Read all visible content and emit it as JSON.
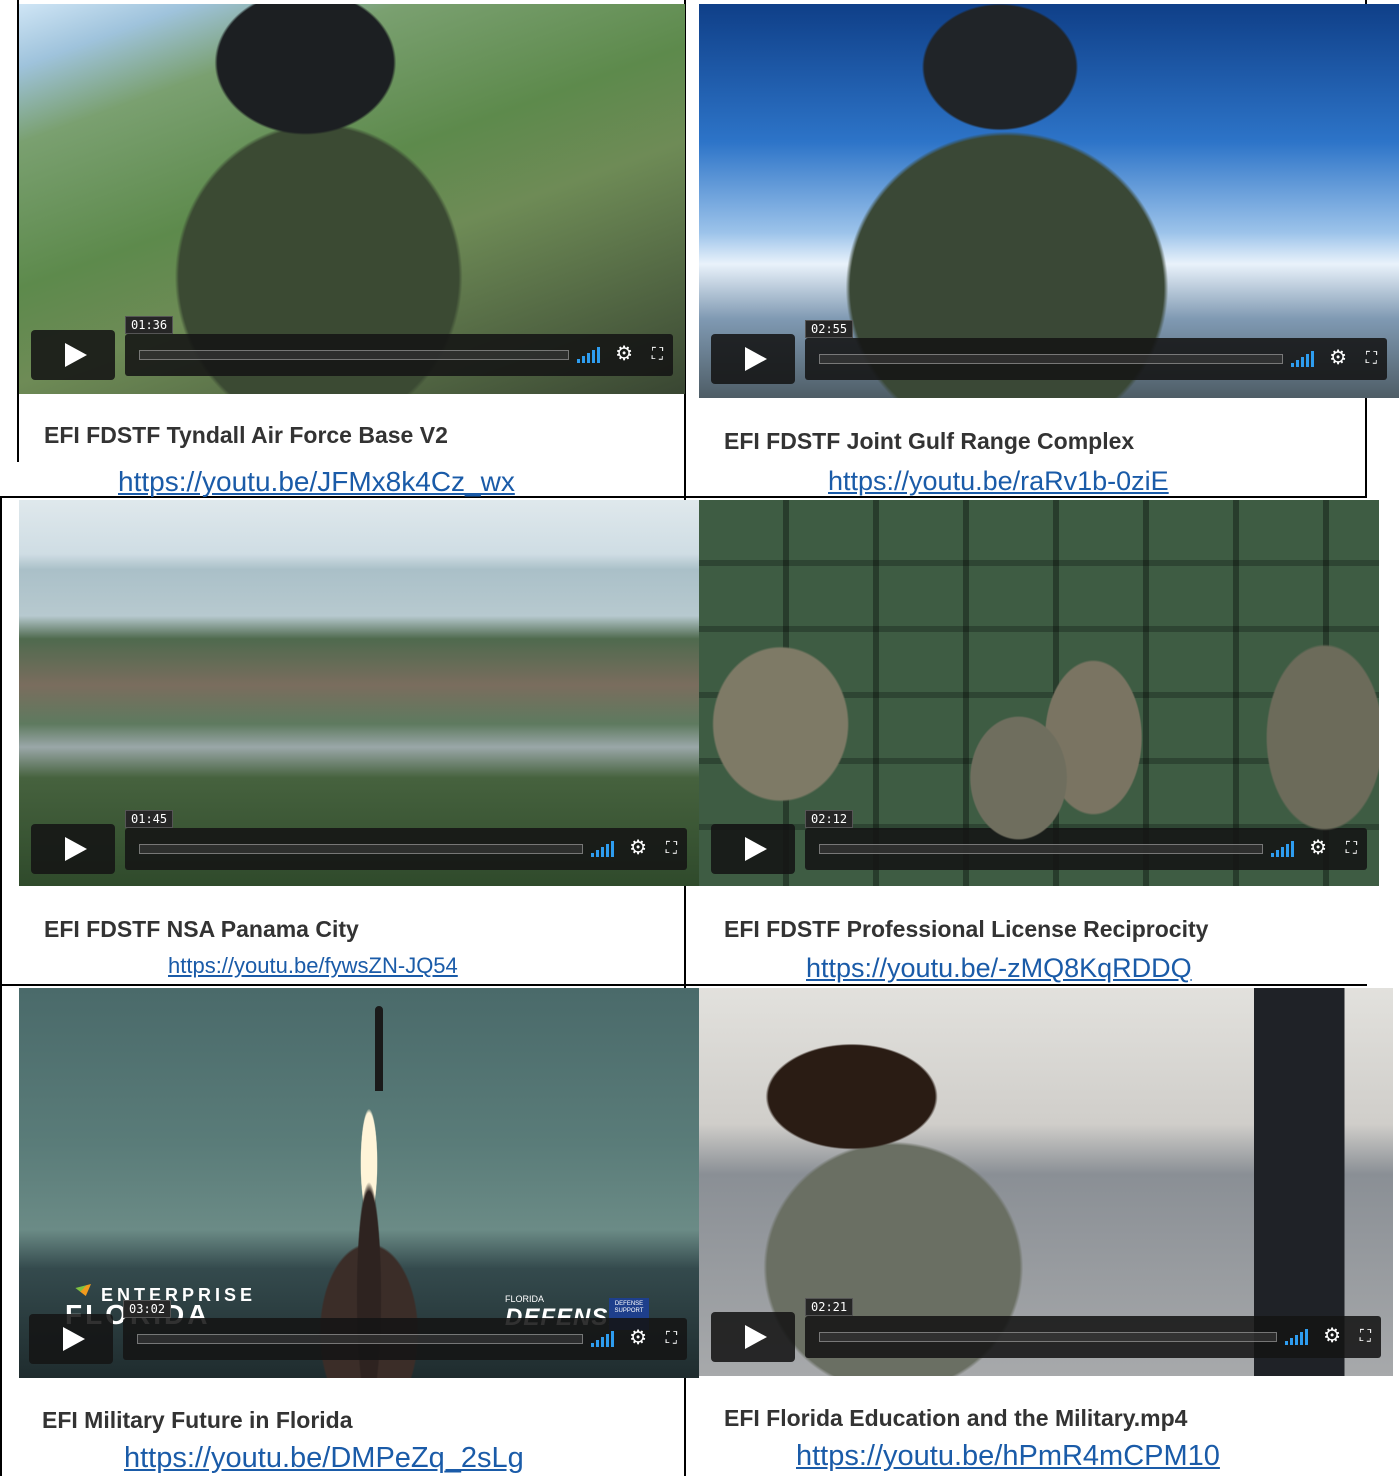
{
  "videos": [
    {
      "title": "EFI FDSTF Tyndall Air Force Base V2",
      "time": "01:36",
      "link": "https://youtu.be/JFMx8k4Cz_wx",
      "thumbnail": "pilot-cockpit-runway"
    },
    {
      "title": "EFI FDSTF Joint Gulf Range Complex",
      "time": "02:55",
      "link": "https://youtu.be/raRv1b-0ziE",
      "thumbnail": "pilot-cockpit-sky"
    },
    {
      "title": "EFI FDSTF NSA Panama City",
      "time": "01:45",
      "link": "https://youtu.be/fywsZN-JQ54",
      "thumbnail": "aerial-naval-base"
    },
    {
      "title": "EFI FDSTF Professional License Reciprocity",
      "time": "02:12",
      "link": "https://youtu.be/-zMQ8KqRDDQ",
      "thumbnail": "airmen-warehouse"
    },
    {
      "title": "EFI Military Future in Florida",
      "time": "03:02",
      "link": "https://youtu.be/DMPeZq_2sLg",
      "thumbnail": "rocket-launch",
      "overlay": {
        "brand_small": "ENTERPRISE",
        "brand_large": "FLORIDA",
        "partner_small": "FLORIDA",
        "partner_large": "DEFENSE",
        "partner_badge": "DEFENSE SUPPORT"
      }
    },
    {
      "title": "EFI Florida Education and the Military.mp4",
      "time": "02:21",
      "link": "https://youtu.be/hPmR4mCPM10",
      "thumbnail": "airman-classroom"
    }
  ],
  "icons": {
    "play": "play-icon",
    "volume": "volume-icon",
    "settings": "gear-icon",
    "fullscreen": "fullscreen-icon"
  },
  "colors": {
    "link": "#1a5ba8",
    "volume": "#2e9df0",
    "title": "#333333"
  }
}
